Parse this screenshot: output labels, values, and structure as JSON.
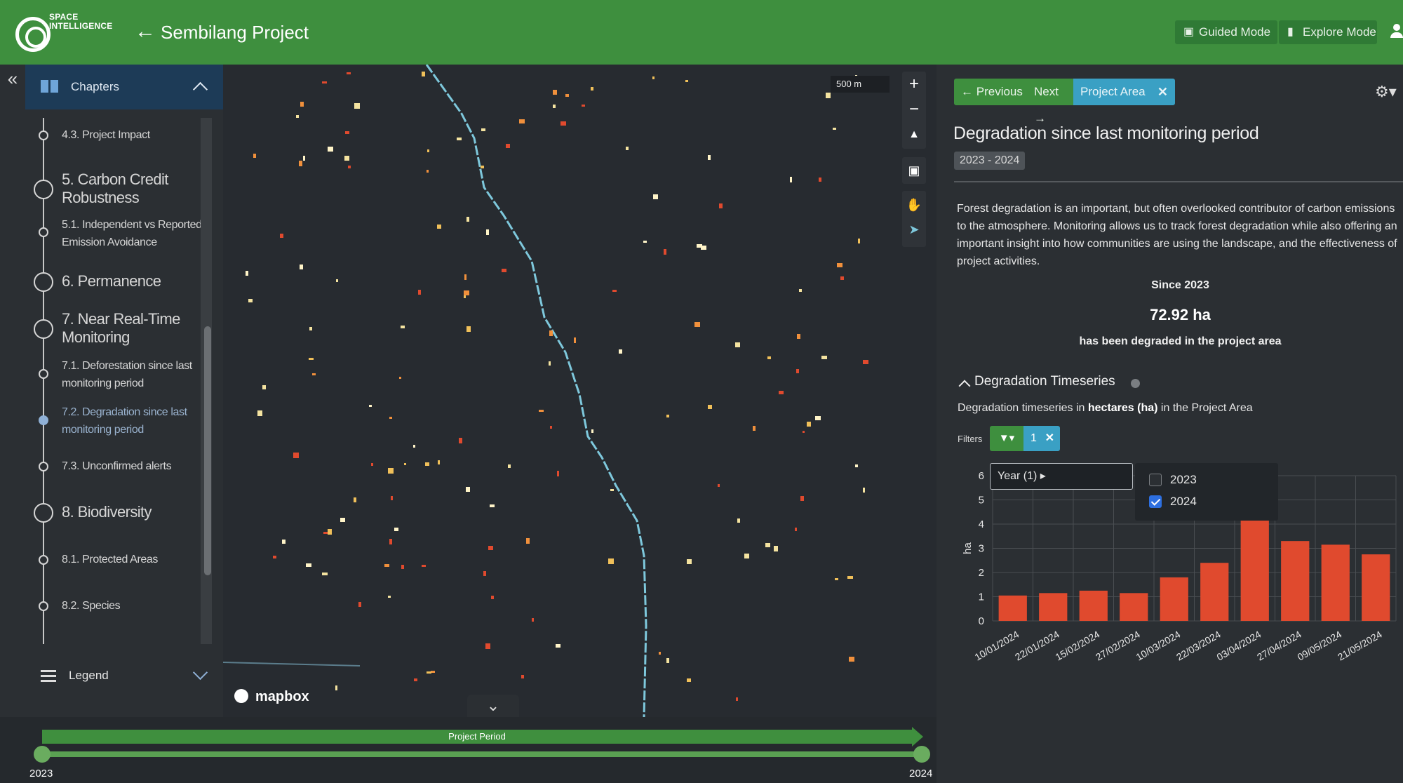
{
  "header": {
    "logo_text": "SPACE INTELLIGENCE",
    "project_title": "Sembilang Project",
    "guided_mode": "Guided Mode",
    "explore_mode": "Explore Mode"
  },
  "sidebar": {
    "chapters_label": "Chapters",
    "legend_label": "Legend",
    "items": [
      {
        "label": "4.3. Project Impact"
      },
      {
        "label": "5. Carbon Credit Robustness"
      },
      {
        "label": "5.1. Independent vs Reported Emission Avoidance"
      },
      {
        "label": "6. Permanence"
      },
      {
        "label": "7. Near Real-Time Monitoring"
      },
      {
        "label": "7.1. Deforestation since last monitoring period"
      },
      {
        "label": "7.2. Degradation since last monitoring period"
      },
      {
        "label": "7.3. Unconfirmed alerts"
      },
      {
        "label": "8. Biodiversity"
      },
      {
        "label": "8.1. Protected Areas"
      },
      {
        "label": "8.2. Species"
      }
    ]
  },
  "map": {
    "scale_label": "500 m",
    "attribution": "mapbox"
  },
  "timeline": {
    "period_label": "Project Period",
    "start_year": "2023",
    "end_year": "2024"
  },
  "panel": {
    "prev_label": "Previous",
    "next_label": "Next",
    "area_label": "Project Area",
    "title": "Degradation since last monitoring period",
    "period_badge": "2023 - 2024",
    "description": "Forest degradation is an important, but often overlooked contributor of carbon emissions to the atmosphere. Monitoring allows us to track forest degradation while also offering an important insight into how communities are using the landscape, and the effectiveness of project activities.",
    "since_label": "Since 2023",
    "since_value": "72.92 ha",
    "since_sub": "has been degraded in the project area",
    "ts_title": "Degradation Timeseries",
    "ts_desc_pre": "Degradation timeseries in ",
    "ts_desc_bold": "hectares (ha)",
    "ts_desc_post": " in the Project Area",
    "filters_label": "Filters",
    "filter_count": "1",
    "year_select": "Year (1) ▸",
    "year_options": [
      {
        "label": "2023",
        "checked": false
      },
      {
        "label": "2024",
        "checked": true
      }
    ]
  },
  "colors": {
    "header_green": "#3e8f3e",
    "accent_blue": "#3aa0c4",
    "bar_red": "#e04a2e",
    "river_cyan": "#7ec8dc"
  },
  "chart_data": {
    "type": "bar",
    "categories": [
      "10/01/2024",
      "22/01/2024",
      "15/02/2024",
      "27/02/2024",
      "10/03/2024",
      "22/03/2024",
      "03/04/2024",
      "27/04/2024",
      "09/05/2024",
      "21/05/2024"
    ],
    "values": [
      1.05,
      1.15,
      1.25,
      1.15,
      1.8,
      2.4,
      4.15,
      3.3,
      3.15,
      2.75
    ],
    "ylabel": "ha",
    "ylim": [
      0,
      6
    ],
    "yticks": [
      "0",
      "1",
      "2",
      "3",
      "4",
      "5",
      "6"
    ],
    "grid": true
  }
}
